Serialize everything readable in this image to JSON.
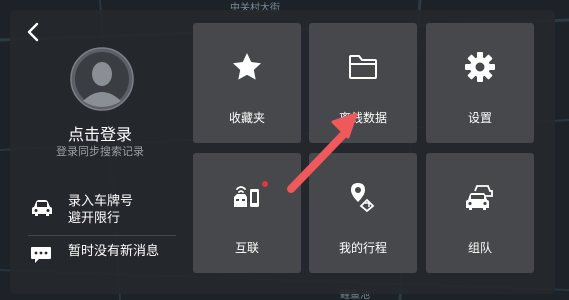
{
  "map": {
    "label_top": "中关村大街",
    "label_bottom": "鲤鱼池"
  },
  "login": {
    "title": "点击登录",
    "subtitle": "登录同步搜索记录"
  },
  "plate": {
    "line1": "录入车牌号",
    "line2": "避开限行"
  },
  "messages": {
    "text": "暂时没有新消息"
  },
  "tiles": [
    {
      "label": "收藏夹",
      "icon": "star-icon"
    },
    {
      "label": "离线数据",
      "icon": "folder-icon"
    },
    {
      "label": "设置",
      "icon": "gear-icon"
    },
    {
      "label": "互联",
      "icon": "phone-car-connect-icon"
    },
    {
      "label": "我的行程",
      "icon": "route-pin-icon"
    },
    {
      "label": "组队",
      "icon": "car-team-icon"
    }
  ],
  "colors": {
    "panel": "#26282c",
    "tile": "#46484c",
    "arrow": "#f0595b",
    "badge": "#e8343c"
  }
}
